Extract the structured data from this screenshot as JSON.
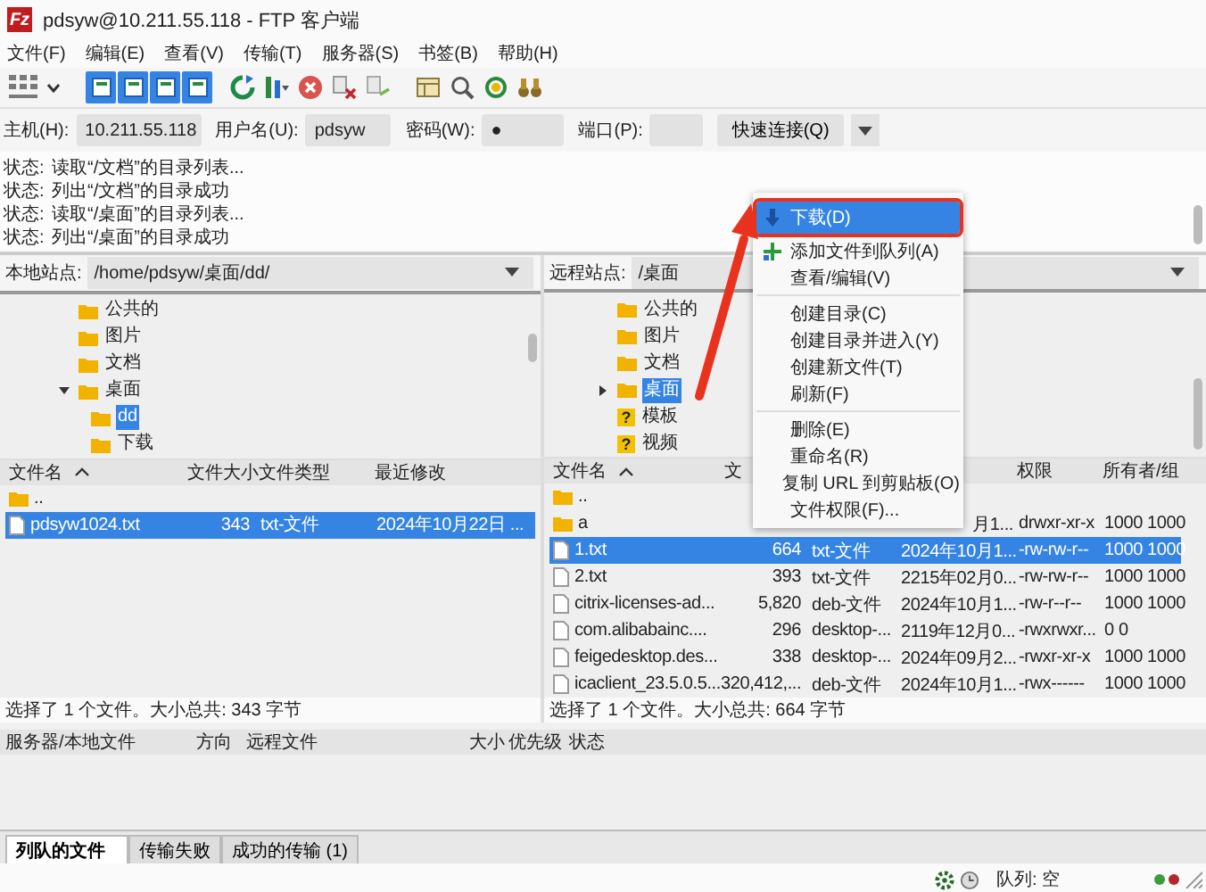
{
  "window": {
    "app_icon": "Fz",
    "title": "pdsyw@10.211.55.118 - FTP 客户端"
  },
  "menu_bar": [
    "文件(F)",
    "编辑(E)",
    "查看(V)",
    "传输(T)",
    "服务器(S)",
    "书签(B)",
    "帮助(H)"
  ],
  "toolbar": {
    "panel_toggles": [
      {
        "on": true
      },
      {
        "on": true
      },
      {
        "on": true
      },
      {
        "on": true
      }
    ]
  },
  "quickconnect": {
    "host_label": "主机(H):",
    "host": "10.211.55.118",
    "user_label": "用户名(U):",
    "user": "pdsyw",
    "password_label": "密码(W):",
    "password": "●",
    "port_label": "端口(P):",
    "button": "快速连接(Q)"
  },
  "message_log": [
    {
      "label": "状态:",
      "text": "读取“/文档”的目录列表..."
    },
    {
      "label": "状态:",
      "text": "列出“/文档”的目录成功"
    },
    {
      "label": "状态:",
      "text": "读取“/桌面”的目录列表..."
    },
    {
      "label": "状态:",
      "text": "列出“/桌面”的目录成功"
    }
  ],
  "local": {
    "site_label": "本地站点:",
    "path": "/home/pdsyw/桌面/dd/",
    "tree": [
      {
        "name": "公共的",
        "selected": false
      },
      {
        "name": "图片",
        "selected": false
      },
      {
        "name": "文档",
        "selected": false
      },
      {
        "name": "桌面",
        "selected": false,
        "expanded": true,
        "children": [
          {
            "name": "dd",
            "selected": true
          },
          {
            "name": "下载",
            "selected": false
          }
        ]
      }
    ],
    "columns": [
      {
        "kind": "name",
        "label": "文件名",
        "sorted": true
      },
      {
        "kind": "size",
        "label": "文件大小",
        "sorted": false
      },
      {
        "kind": "type",
        "label": "文件类型",
        "sorted": false
      },
      {
        "kind": "modified",
        "label": "最近修改",
        "sorted": false
      }
    ],
    "files": [
      {
        "kind": "folder",
        "name": "..",
        "selected": false
      },
      {
        "kind": "file",
        "name": "pdsyw1024.txt",
        "size": "343",
        "type": "txt-文件",
        "modified": "2024年10月22日 ...",
        "selected": true
      }
    ],
    "status": "选择了 1 个文件。大小总共: 343 字节"
  },
  "remote": {
    "site_label": "远程站点:",
    "path": "/桌面",
    "tree": [
      {
        "name": "公共的",
        "selected": false
      },
      {
        "name": "图片",
        "selected": false
      },
      {
        "name": "文档",
        "selected": false
      },
      {
        "name": "桌面",
        "selected": true,
        "expanded": false
      },
      {
        "name": "模板",
        "icon": "?",
        "selected": false
      },
      {
        "name": "视频",
        "icon": "?",
        "selected": false
      }
    ],
    "columns": [
      {
        "kind": "name",
        "label": "文件名",
        "sorted": true
      },
      {
        "kind": "size",
        "label": "文",
        "sorted": false
      },
      {
        "kind": "permissions",
        "label": "权限",
        "sorted": false
      },
      {
        "kind": "owner",
        "label": "所有者/组",
        "sorted": false
      }
    ],
    "files": [
      {
        "kind": "folder",
        "name": "..",
        "selected": false
      },
      {
        "kind": "folder",
        "name": "a",
        "modified": "月1...",
        "permissions": "drwxr-xr-x",
        "owner": "1000 1000",
        "selected": false
      },
      {
        "kind": "file",
        "name": "1.txt",
        "size": "664",
        "type": "txt-文件",
        "modified": "2024年10月1...",
        "permissions": "-rw-rw-r--",
        "owner": "1000 1000",
        "selected": true
      },
      {
        "kind": "file",
        "name": "2.txt",
        "size": "393",
        "type": "txt-文件",
        "modified": "2215年02月0...",
        "permissions": "-rw-rw-r--",
        "owner": "1000 1000",
        "selected": false
      },
      {
        "kind": "file",
        "name": "citrix-licenses-ad...",
        "size": "5,820",
        "type": "deb-文件",
        "modified": "2024年10月1...",
        "permissions": "-rw-r--r--",
        "owner": "1000 1000",
        "selected": false
      },
      {
        "kind": "file",
        "name": "com.alibabainc....",
        "size": "296",
        "type": "desktop-...",
        "modified": "2119年12月0...",
        "permissions": "-rwxrwxr...",
        "owner": "0 0",
        "selected": false
      },
      {
        "kind": "file",
        "name": "feigedesktop.des...",
        "size": "338",
        "type": "desktop-...",
        "modified": "2024年09月2...",
        "permissions": "-rwxr-xr-x",
        "owner": "1000 1000",
        "selected": false
      },
      {
        "kind": "file",
        "name": "icaclient_23.5.0.5...",
        "size": "320,412,...",
        "type": "deb-文件",
        "modified": "2024年10月1...",
        "permissions": "-rwx------",
        "owner": "1000 1000",
        "selected": false
      }
    ],
    "status": "选择了 1 个文件。大小总共: 664 字节"
  },
  "context_menu": [
    {
      "kind": "download",
      "label": "下载(D)",
      "selected": true
    },
    {
      "kind": "enqueue",
      "label": "添加文件到队列(A)",
      "selected": false
    },
    {
      "kind": "item",
      "label": "查看/编辑(V)",
      "selected": false
    },
    {
      "kind": "separator"
    },
    {
      "kind": "item",
      "label": "创建目录(C)",
      "selected": false
    },
    {
      "kind": "item",
      "label": "创建目录并进入(Y)",
      "selected": false
    },
    {
      "kind": "item",
      "label": "创建新文件(T)",
      "selected": false
    },
    {
      "kind": "item",
      "label": "刷新(F)",
      "selected": false
    },
    {
      "kind": "separator"
    },
    {
      "kind": "item",
      "label": "删除(E)",
      "selected": false
    },
    {
      "kind": "item",
      "label": "重命名(R)",
      "selected": false
    },
    {
      "kind": "item",
      "label": "复制 URL 到剪贴板(O)",
      "selected": false
    },
    {
      "kind": "item",
      "label": "文件权限(F)...",
      "selected": false
    }
  ],
  "queue": {
    "columns": [
      "服务器/本地文件",
      "方向",
      "远程文件",
      "大小",
      "优先级",
      "状态"
    ],
    "tabs": [
      {
        "label": "列队的文件",
        "selected": true
      },
      {
        "label": "传输失败",
        "selected": false
      },
      {
        "label": "成功的传输 (1)",
        "selected": false
      }
    ]
  },
  "status_bar": {
    "queue": "队列: 空",
    "indicators": [
      {
        "color": "#3a9d3a"
      },
      {
        "color": "#b3262d"
      }
    ]
  }
}
